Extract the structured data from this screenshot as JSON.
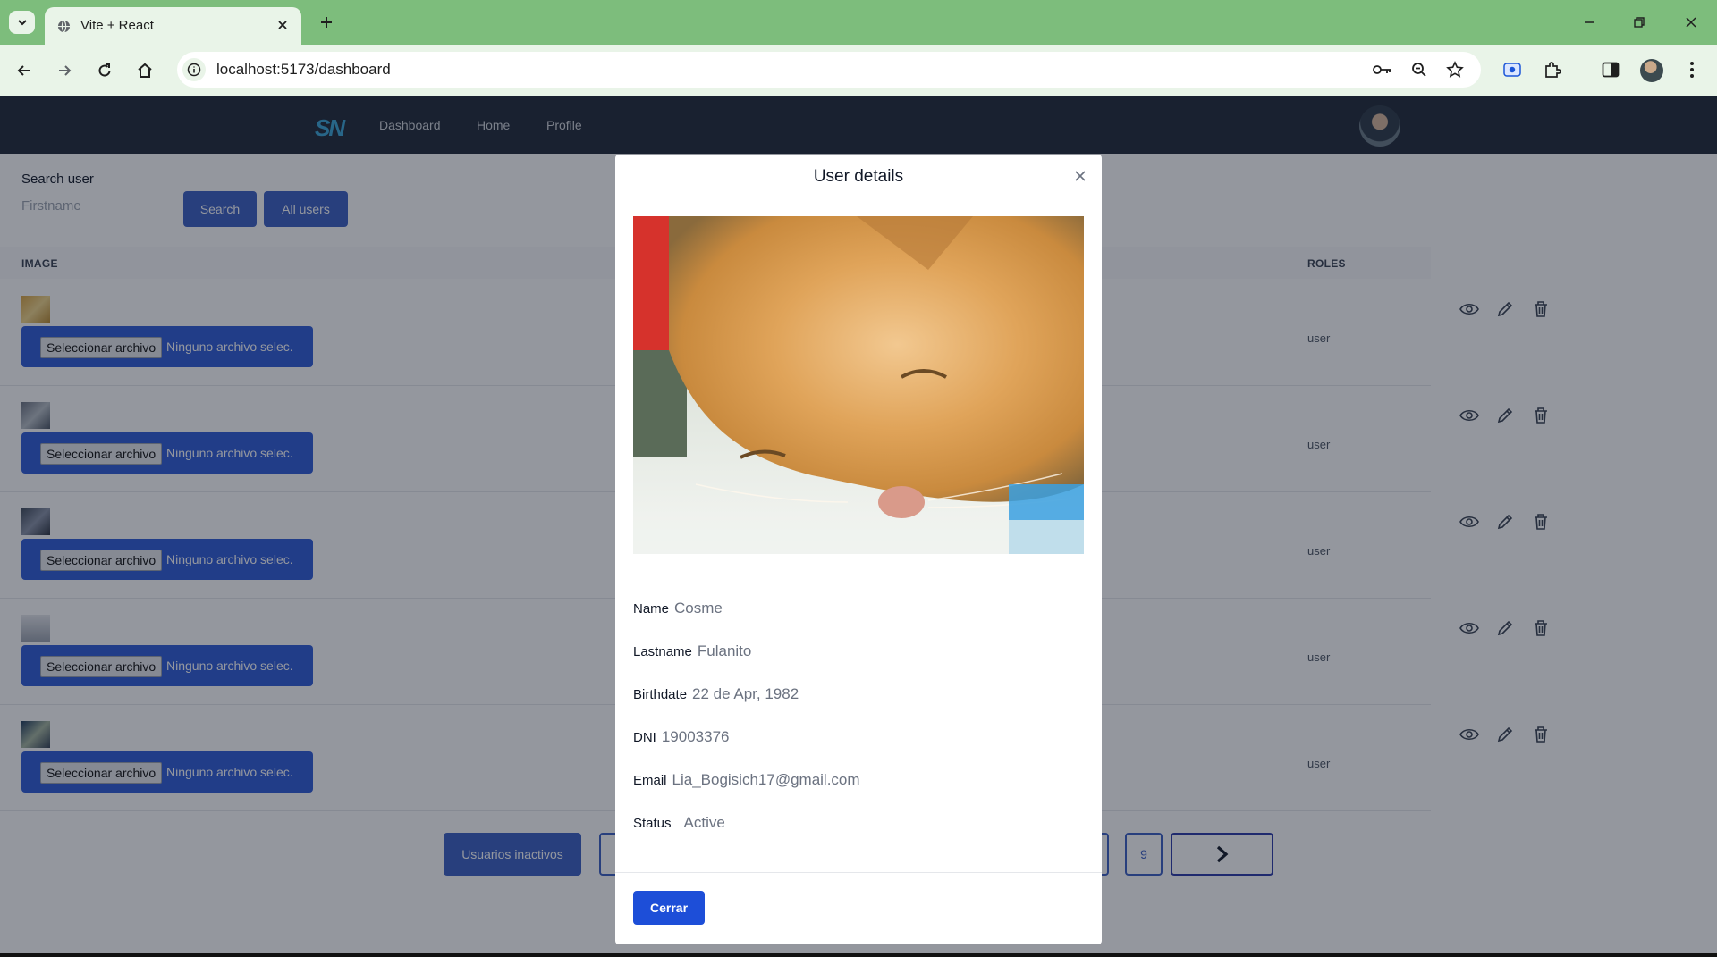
{
  "browser": {
    "tab_title": "Vite + React",
    "url": "localhost:5173/dashboard"
  },
  "app": {
    "logo": "SN",
    "nav": [
      "Dashboard",
      "Home",
      "Profile"
    ]
  },
  "search": {
    "label": "Search user",
    "placeholder": "Firstname",
    "search_button": "Search",
    "all_users_button": "All users"
  },
  "table": {
    "headers": {
      "image": "IMAGE",
      "roles": "ROLES"
    },
    "file_button": "Seleccionar archivo",
    "file_status": "Ninguno archivo selec.",
    "rows": [
      {
        "role": "user"
      },
      {
        "role": "user"
      },
      {
        "role": "user"
      },
      {
        "role": "user"
      },
      {
        "role": "user"
      }
    ]
  },
  "footer": {
    "inactive_button": "Usuarios inactivos",
    "page_last": "9",
    "next_icon": "chevron-right-icon"
  },
  "modal": {
    "title": "User details",
    "fields": {
      "name_label": "Name",
      "name": "Cosme",
      "lastname_label": "Lastname",
      "lastname": "Fulanito",
      "birthdate_label": "Birthdate",
      "birthdate": "22 de Apr, 1982",
      "dni_label": "DNI",
      "dni": "19003376",
      "email_label": "Email",
      "email": "Lia_Bogisich17@gmail.com",
      "status_label": "Status",
      "status": "Active"
    },
    "close_button": "Cerrar"
  },
  "colors": {
    "chrome": "#7dbd7c",
    "nav_bg": "#1f2937",
    "primary": "#3b5fc4",
    "cerrar": "#1d4ed8"
  }
}
